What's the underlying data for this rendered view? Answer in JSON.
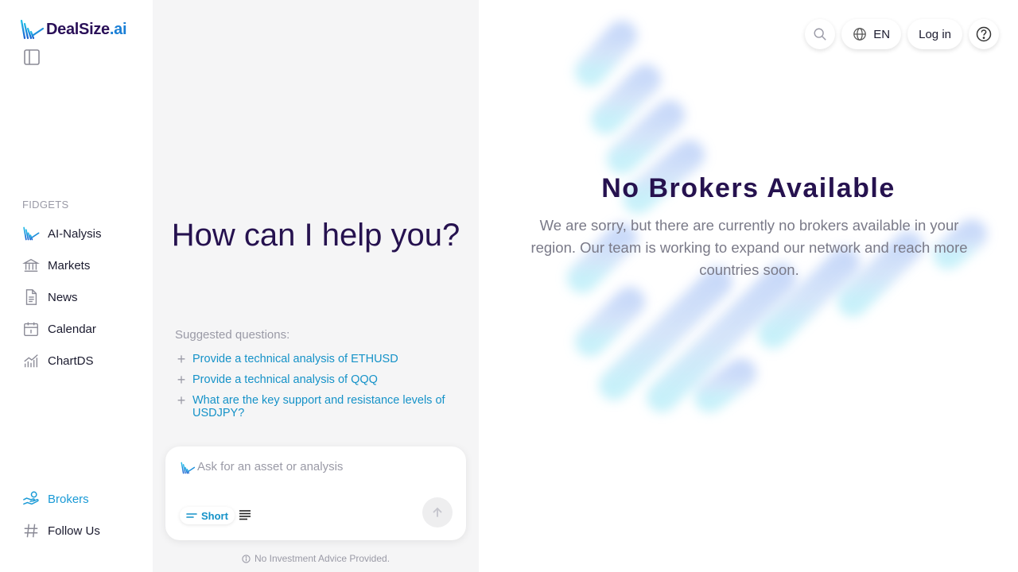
{
  "brand": {
    "name_main": "DealSize",
    "name_suffix": ".ai"
  },
  "sidebar": {
    "section_label": "FIDGETS",
    "items": [
      {
        "label": "AI-Nalysis",
        "icon": "ai-logo-icon"
      },
      {
        "label": "Markets",
        "icon": "bank-icon"
      },
      {
        "label": "News",
        "icon": "document-icon"
      },
      {
        "label": "Calendar",
        "icon": "calendar-icon"
      },
      {
        "label": "ChartDS",
        "icon": "chart-icon"
      }
    ],
    "bottom_items": [
      {
        "label": "Brokers",
        "icon": "handshake-icon",
        "active": true
      },
      {
        "label": "Follow Us",
        "icon": "hashtag-icon"
      }
    ]
  },
  "chat": {
    "heading": "How can I help you?",
    "suggest_label": "Suggested questions:",
    "suggestions": [
      "Provide a technical analysis of ETHUSD",
      "Provide a technical analysis of QQQ",
      "What are the key support and resistance levels of USDJPY?"
    ],
    "input_placeholder": "Ask for an asset or analysis",
    "mode_label": "Short",
    "disclaimer": "No Investment Advice Provided."
  },
  "topbar": {
    "language": "EN",
    "login_label": "Log in"
  },
  "main": {
    "title": "No Brokers Available",
    "message": "We are sorry, but there are currently no brokers available in your region. Our team is working to expand our network and reach more countries soon."
  },
  "colors": {
    "accent": "#1a9ad6",
    "heading": "#26124f",
    "panel_bg": "#f5f5f6"
  }
}
